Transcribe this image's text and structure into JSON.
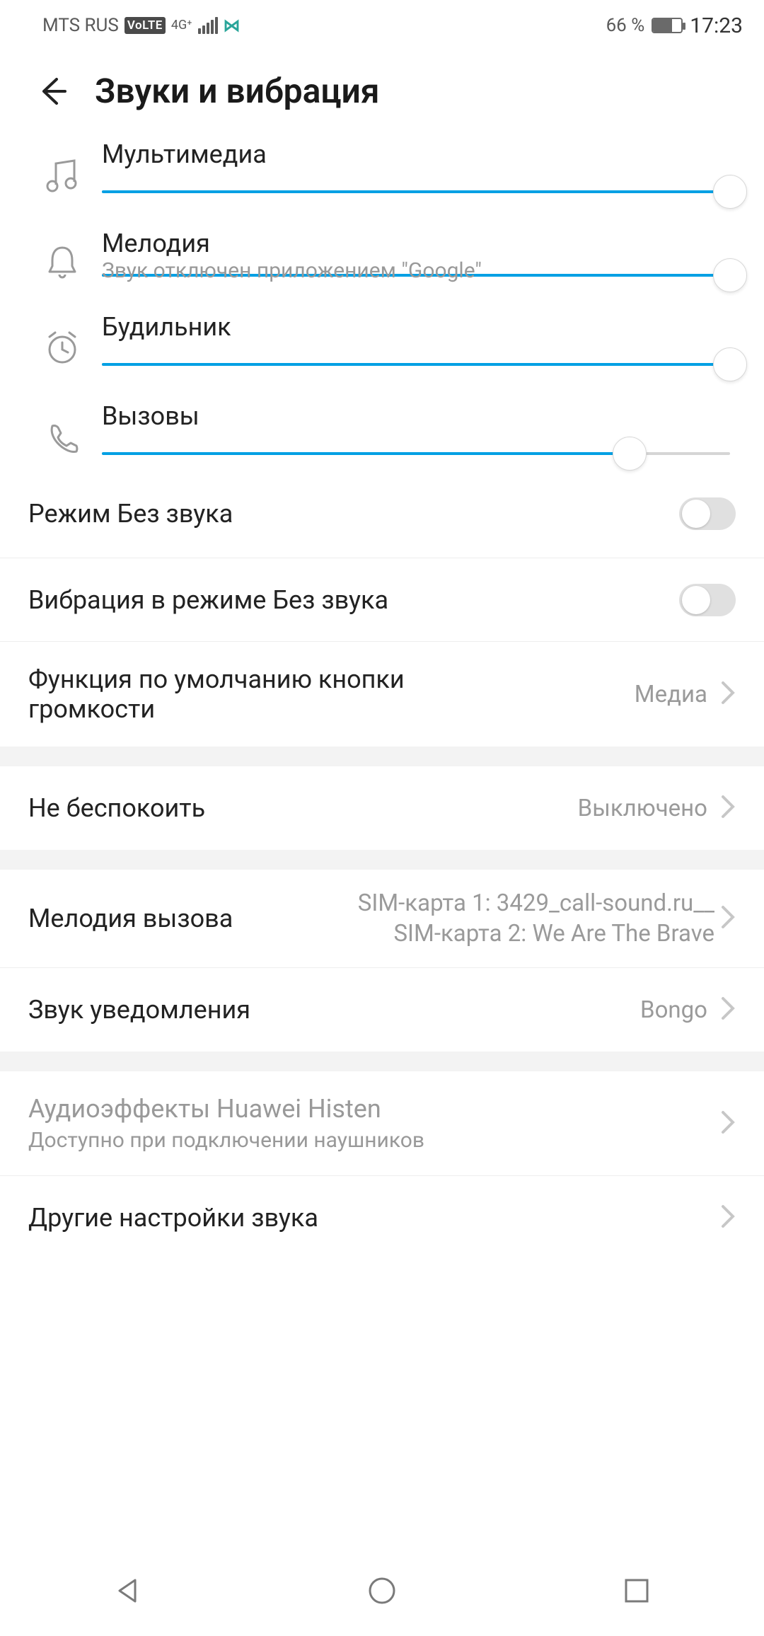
{
  "statusbar": {
    "carrier": "MTS RUS",
    "volte": "VoLTE",
    "network": "4G⁺",
    "battery_text": "66 %",
    "time": "17:23"
  },
  "header": {
    "title": "Звуки и вибрация"
  },
  "sliders": {
    "media": {
      "label": "Мультимедиа",
      "value": 100
    },
    "ringtone": {
      "label": "Мелодия",
      "value": 100,
      "hint": "Звук отключен приложением \"Google\""
    },
    "alarm": {
      "label": "Будильник",
      "value": 100
    },
    "calls": {
      "label": "Вызовы",
      "value": 84
    }
  },
  "settings": {
    "silent_mode": {
      "label": "Режим Без звука",
      "on": false
    },
    "vibrate_silent": {
      "label": "Вибрация в режиме Без звука",
      "on": false
    },
    "volume_key": {
      "label": "Функция по умолчанию кнопки громкости",
      "value": "Медиа"
    },
    "dnd": {
      "label": "Не беспокоить",
      "value": "Выключено"
    },
    "call_ringtone": {
      "label": "Мелодия вызова",
      "sim1": "SIM-карта 1: 3429_call-sound.ru__",
      "sim2": "SIM-карта 2: We Are The Brave"
    },
    "notification_sound": {
      "label": "Звук уведомления",
      "value": "Bongo"
    },
    "histen": {
      "label": "Аудиоэффекты Huawei Histen",
      "sub": "Доступно при подключении наушников"
    },
    "other_sounds": {
      "label": "Другие настройки звука"
    }
  }
}
